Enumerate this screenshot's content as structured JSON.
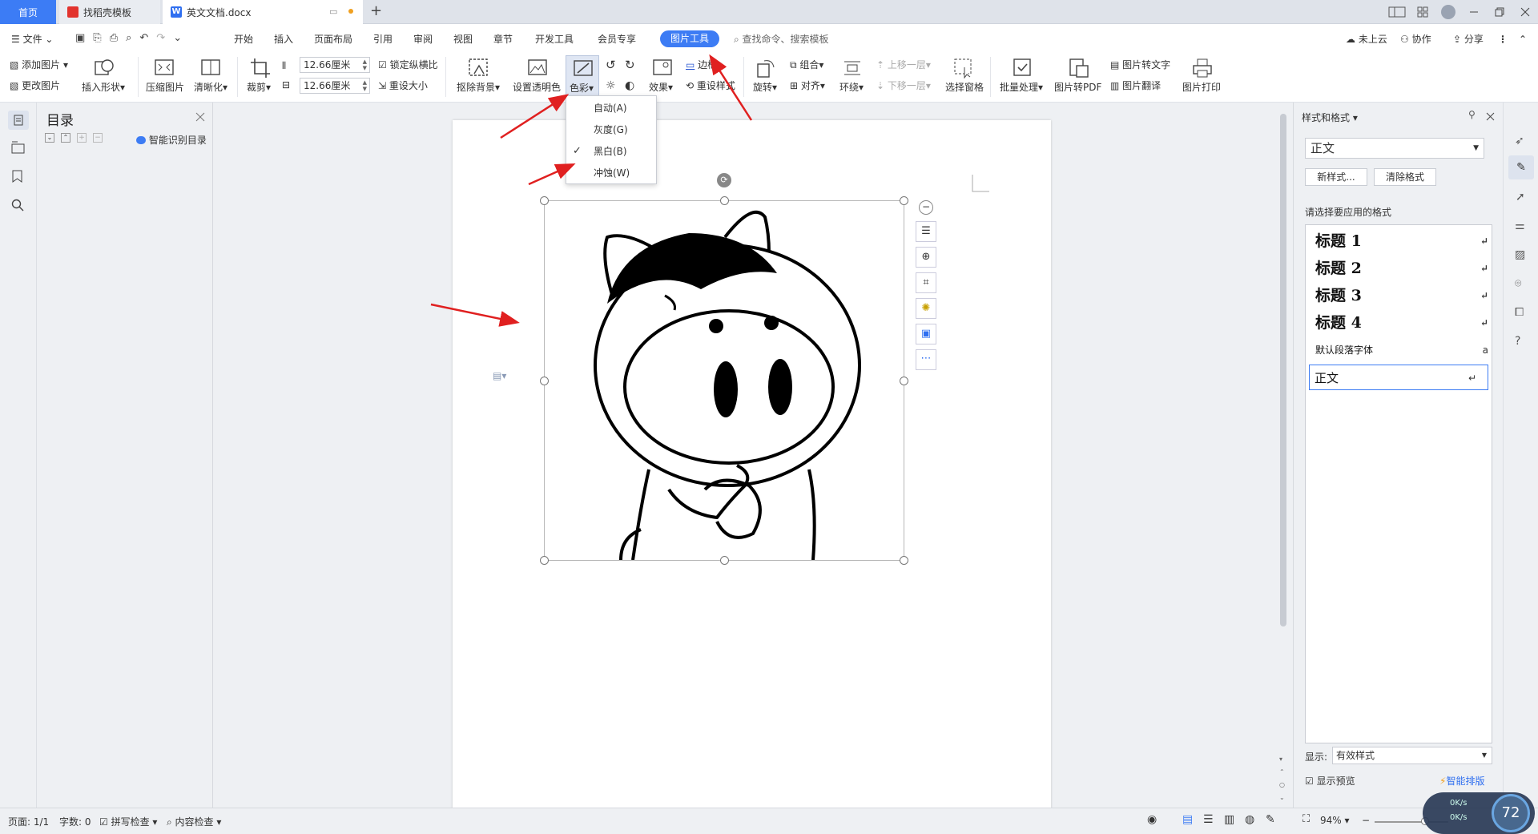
{
  "tabs": {
    "home": "首页",
    "template": "找稻壳模板",
    "document": "英文文档.docx",
    "new_tab": "+"
  },
  "menu": {
    "file": "文件",
    "items": [
      "开始",
      "插入",
      "页面布局",
      "引用",
      "审阅",
      "视图",
      "章节",
      "开发工具",
      "会员专享"
    ],
    "active": "图片工具",
    "search_placeholder": "查找命令、搜索模板",
    "cloud": "未上云",
    "collab": "协作",
    "share": "分享"
  },
  "ribbon": {
    "add_picture": "添加图片",
    "change_picture": "更改图片",
    "insert_shape": "插入形状",
    "compress": "压缩图片",
    "sharpen": "清晰化",
    "crop": "裁剪",
    "width_value": "12.66厘米",
    "height_value": "12.66厘米",
    "lock_ratio": "锁定纵横比",
    "reset_size": "重设大小",
    "remove_bg": "抠除背景",
    "set_transparent": "设置透明色",
    "color": "色彩",
    "effects": "效果",
    "border": "边框",
    "reset_style": "重设样式",
    "rotate": "旋转",
    "group": "组合",
    "align": "对齐",
    "wrap": "环绕",
    "bring_forward": "上移一层",
    "send_backward": "下移一层",
    "selection_pane": "选择窗格",
    "batch": "批量处理",
    "to_pdf": "图片转PDF",
    "to_text": "图片转文字",
    "translate": "图片翻译",
    "print": "图片打印"
  },
  "color_menu": {
    "items": [
      {
        "label": "自动(A)",
        "checked": false
      },
      {
        "label": "灰度(G)",
        "checked": false
      },
      {
        "label": "黑白(B)",
        "checked": true
      },
      {
        "label": "冲蚀(W)",
        "checked": false
      }
    ]
  },
  "toc": {
    "title": "目录",
    "smart": "智能识别目录"
  },
  "styles_panel": {
    "title": "样式和格式",
    "current": "正文",
    "new_style": "新样式...",
    "clear_format": "清除格式",
    "prompt": "请选择要应用的格式",
    "list": [
      "标题 1",
      "标题 2",
      "标题 3",
      "标题 4",
      "默认段落字体",
      "正文"
    ],
    "show_label": "显示:",
    "show_value": "有效样式",
    "preview": "显示预览",
    "smart_layout": "智能排版"
  },
  "status": {
    "page": "页面: 1/1",
    "words": "字数: 0",
    "spell": "拼写检查",
    "content": "内容检查",
    "zoom": "94%",
    "net_up": "0K/s",
    "net_down": "0K/s",
    "badge": "72"
  },
  "colors": {
    "accent": "#3d7cf4",
    "arrow": "#e02020"
  }
}
